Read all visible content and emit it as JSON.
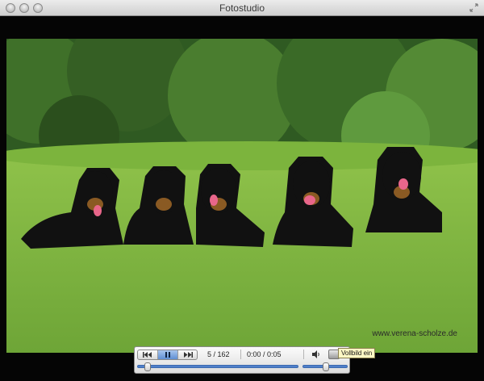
{
  "window": {
    "title": "Fotostudio"
  },
  "photo": {
    "watermark": "www.verena-scholze.de"
  },
  "player": {
    "counter": "5 / 162",
    "time": "0:00 / 0:05",
    "tooltip": "Vollbild ein",
    "position_fraction": 0.05,
    "volume_fraction": 0.55,
    "state": "playing"
  },
  "colors": {
    "accent": "#4f7fc9",
    "tooltip_bg": "#fef8c5"
  },
  "icons": [
    "prev-icon",
    "pause-icon",
    "next-icon",
    "speaker-icon",
    "fullscreen-icon"
  ]
}
